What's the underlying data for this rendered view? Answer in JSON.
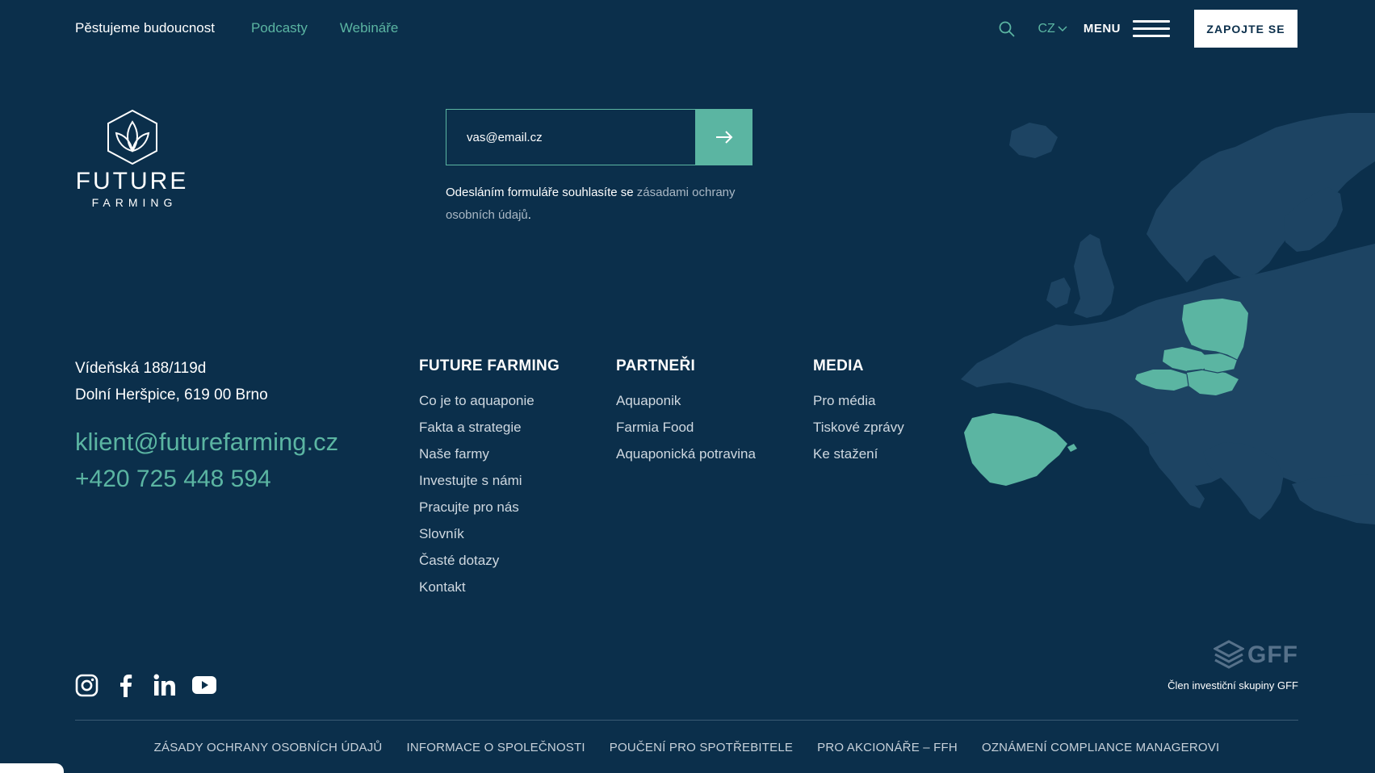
{
  "header": {
    "brand": "Pěstujeme budoucnost",
    "nav": [
      "Podcasty",
      "Webináře"
    ],
    "language": "CZ",
    "menu_label": "MENU",
    "cta_label": "ZAPOJTE SE",
    "icons": {
      "search": "search-icon",
      "lang": "chevron-down-icon",
      "menu": "hamburger-icon"
    }
  },
  "logo": {
    "word": "FUTURE",
    "sub": "FARMING"
  },
  "newsletter": {
    "placeholder": "vas@email.cz",
    "consent_text": "Odesláním formuláře souhlasíte se ",
    "consent_link": "zásadami ochrany osobních údajů",
    "consent_end": "."
  },
  "contact": {
    "address_line1": "Vídeňská 188/119d",
    "address_line2": "Dolní Heršpice, 619 00 Brno",
    "email": "klient@futurefarming.cz",
    "phone": "+420 725 448 594"
  },
  "columns": {
    "future_farming": {
      "title": "FUTURE FARMING",
      "items": [
        "Co je to aquaponie",
        "Fakta a strategie",
        "Naše farmy",
        "Investujte s námi",
        "Pracujte pro nás",
        "Slovník",
        "Časté dotazy",
        "Kontakt"
      ]
    },
    "partneri": {
      "title": "PARTNEŘI",
      "items": [
        "Aquaponik",
        "Farmia Food",
        "Aquaponická potravina"
      ]
    },
    "media": {
      "title": "MEDIA",
      "items": [
        "Pro média",
        "Tiskové zprávy",
        "Ke stažení"
      ]
    }
  },
  "social": [
    "instagram-icon",
    "facebook-icon",
    "linkedin-icon",
    "youtube-icon"
  ],
  "gff": {
    "logo_text": "GFF",
    "member_text": "Člen investiční skupiny GFF"
  },
  "footer_links": [
    "ZÁSADY OCHRANY OSOBNÍCH ÚDAJŮ",
    "INFORMACE O SPOLEČNOSTI",
    "POUČENÍ PRO SPOTŘEBITELE",
    "PRO AKCIONÁŘE – FFH",
    "OZNÁMENÍ COMPLIANCE MANAGEROVI"
  ],
  "colors": {
    "background": "#0b2f4b",
    "accent": "#5bb5a2",
    "map_land": "#1d4463",
    "map_highlight": "#5bb5a2"
  }
}
